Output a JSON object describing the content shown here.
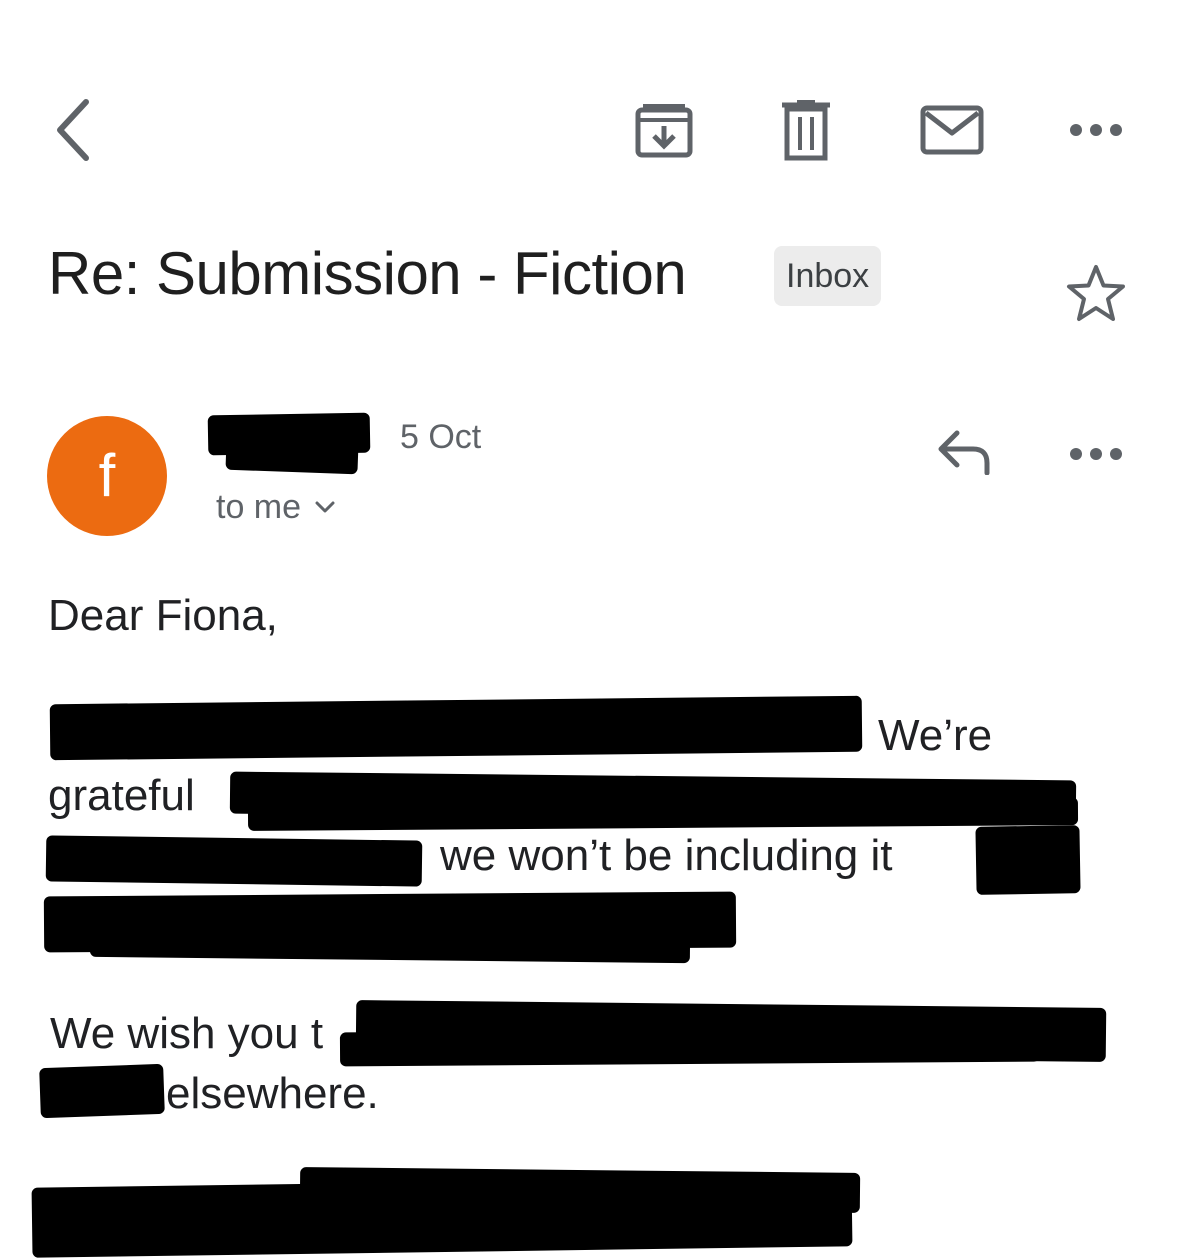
{
  "toolbar": {
    "back_icon": "back-arrow-icon",
    "archive_icon": "archive-icon",
    "delete_icon": "trash-icon",
    "mark_unread_icon": "mail-icon",
    "more_icon": "more-horizontal-icon"
  },
  "email": {
    "subject": "Re: Submission - Fiction",
    "label": "Inbox",
    "star_icon": "star-outline-icon"
  },
  "message": {
    "avatar_letter": "f",
    "avatar_color": "#ec6b11",
    "date": "5 Oct",
    "recipients": "to me",
    "reply_icon": "reply-icon",
    "more_icon": "more-horizontal-icon",
    "body": {
      "greeting": "Dear Fiona,",
      "p1_fragment_1": "We’re",
      "p1_fragment_2": "grateful",
      "p1_fragment_3": "we won’t be including it",
      "p2_fragment_1": "We wish you t",
      "p2_fragment_2": "elsewhere."
    }
  }
}
